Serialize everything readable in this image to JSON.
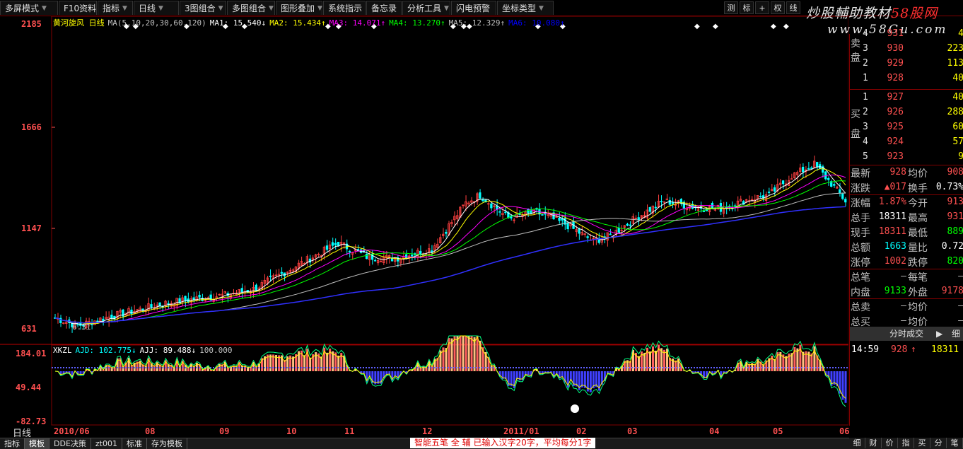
{
  "toolbar": {
    "items": [
      {
        "label": "多屏模式",
        "dropdown": true
      },
      {
        "label": "F10资料",
        "dropdown": false
      },
      {
        "label": "指标",
        "dropdown": true
      },
      {
        "label": "日线",
        "dropdown": true
      },
      {
        "label": "3图组合",
        "dropdown": true
      },
      {
        "label": "多图组合",
        "dropdown": true
      },
      {
        "label": "图形叠加",
        "dropdown": true
      },
      {
        "label": "系统指示",
        "dropdown": false
      },
      {
        "label": "备忘录",
        "dropdown": false
      },
      {
        "label": "分析工具",
        "dropdown": true
      },
      {
        "label": "闪电预警",
        "dropdown": false
      },
      {
        "label": "坐标类型",
        "dropdown": true
      }
    ],
    "right_buttons": [
      "测",
      "标",
      "+",
      "权",
      "线"
    ]
  },
  "watermark": {
    "line1_a": "炒股輔助教材",
    "line1_b": "58股网",
    "line2": "www.58Gu.com"
  },
  "main_chart": {
    "y_labels": [
      "2185",
      "1666",
      "1147",
      "631"
    ],
    "low_marker": "6.31",
    "ma_legend": [
      {
        "text": "黄河旋风 日线",
        "color": "#ffff00"
      },
      {
        "text": "MA(5,10,20,30,60,120)",
        "color": "#c0c0c0"
      },
      {
        "text": "MA1: 15.540↓",
        "color": "#ffffff"
      },
      {
        "text": "MA2: 15.434↑",
        "color": "#ffff00"
      },
      {
        "text": "MA3: 14.071↑",
        "color": "#ff00ff"
      },
      {
        "text": "MA4: 13.270↑",
        "color": "#00ff00"
      },
      {
        "text": "MA5: 12.329↑",
        "color": "#c0c0c0"
      },
      {
        "text": "MA6: 10.080↑",
        "color": "#0000ff"
      }
    ]
  },
  "indicator": {
    "y_labels": [
      "184.01",
      "49.44",
      "-82.73"
    ],
    "legend": [
      {
        "text": "XKZL",
        "color": "#ffffff"
      },
      {
        "text": "AJD: 102.775↓",
        "color": "#00ffff"
      },
      {
        "text": "AJJ: 89.488↓",
        "color": "#ffffff"
      },
      {
        "text": "100.000",
        "color": "#c0c0c0"
      }
    ]
  },
  "x_labels": [
    "2010/06",
    "08",
    "09",
    "10",
    "11",
    "12",
    "2011/01",
    "02",
    "03",
    "04",
    "05",
    "06"
  ],
  "daily_label": "日线",
  "bottom_tabs": [
    "指标",
    "模板",
    "DDE决策",
    "zt001",
    "标准",
    "存为模板"
  ],
  "ticker": "智能五笔 全 辅   已输入汉字20字，平均每分1字",
  "order_book": {
    "sell_side": "卖盘",
    "buy_side": "买盘",
    "sells": [
      {
        "level": "4",
        "price": "931",
        "vol": "4"
      },
      {
        "level": "3",
        "price": "930",
        "vol": "223"
      },
      {
        "level": "2",
        "price": "929",
        "vol": "113"
      },
      {
        "level": "1",
        "price": "928",
        "vol": "40"
      }
    ],
    "buys": [
      {
        "level": "1",
        "price": "927",
        "vol": "40"
      },
      {
        "level": "2",
        "price": "926",
        "vol": "288"
      },
      {
        "level": "3",
        "price": "925",
        "vol": "60"
      },
      {
        "level": "4",
        "price": "924",
        "vol": "57"
      },
      {
        "level": "5",
        "price": "923",
        "vol": "9"
      }
    ]
  },
  "quote": [
    {
      "l1": "最新",
      "v1": "928",
      "c1": "#ff5050",
      "l2": "均价",
      "v2": "908",
      "c2": "#ff5050"
    },
    {
      "l1": "涨跌",
      "v1": "▲017",
      "c1": "#ff5050",
      "l2": "换手",
      "v2": "0.73%",
      "c2": "#ffffff"
    },
    {
      "l1": "涨幅",
      "v1": "1.87%",
      "c1": "#ff5050",
      "l2": "今开",
      "v2": "913",
      "c2": "#ff5050"
    },
    {
      "l1": "总手",
      "v1": "18311",
      "c1": "#ffffff",
      "l2": "最高",
      "v2": "931",
      "c2": "#ff5050"
    },
    {
      "l1": "现手",
      "v1": "18311",
      "c1": "#ff5050",
      "l2": "最低",
      "v2": "889",
      "c2": "#00ff00"
    },
    {
      "l1": "总额",
      "v1": "1663",
      "c1": "#00ffff",
      "l2": "量比",
      "v2": "0.72",
      "c2": "#ffffff"
    },
    {
      "l1": "涨停",
      "v1": "1002",
      "c1": "#ff5050",
      "l2": "跌停",
      "v2": "820",
      "c2": "#00ff00"
    },
    {
      "l1": "总笔",
      "v1": "—",
      "c1": "#c0c0c0",
      "l2": "每笔",
      "v2": "—",
      "c2": "#c0c0c0"
    },
    {
      "l1": "内盘",
      "v1": "9133",
      "c1": "#00ff00",
      "l2": "外盘",
      "v2": "9178",
      "c2": "#ff5050"
    },
    {
      "l1": "总卖",
      "v1": "—",
      "c1": "#c0c0c0",
      "l2": "均价",
      "v2": "—",
      "c2": "#c0c0c0"
    },
    {
      "l1": "总买",
      "v1": "—",
      "c1": "#c0c0c0",
      "l2": "均价",
      "v2": "—",
      "c2": "#c0c0c0"
    }
  ],
  "time_sales": {
    "header": "分时成交",
    "arrow": "▶",
    "suffix": "细",
    "row": {
      "time": "14:59",
      "price": "928",
      "arrow": "↑",
      "vol": "18311"
    }
  },
  "right_bottom_tabs": [
    "细",
    "财",
    "价",
    "指",
    "买",
    "分",
    "笔"
  ]
}
